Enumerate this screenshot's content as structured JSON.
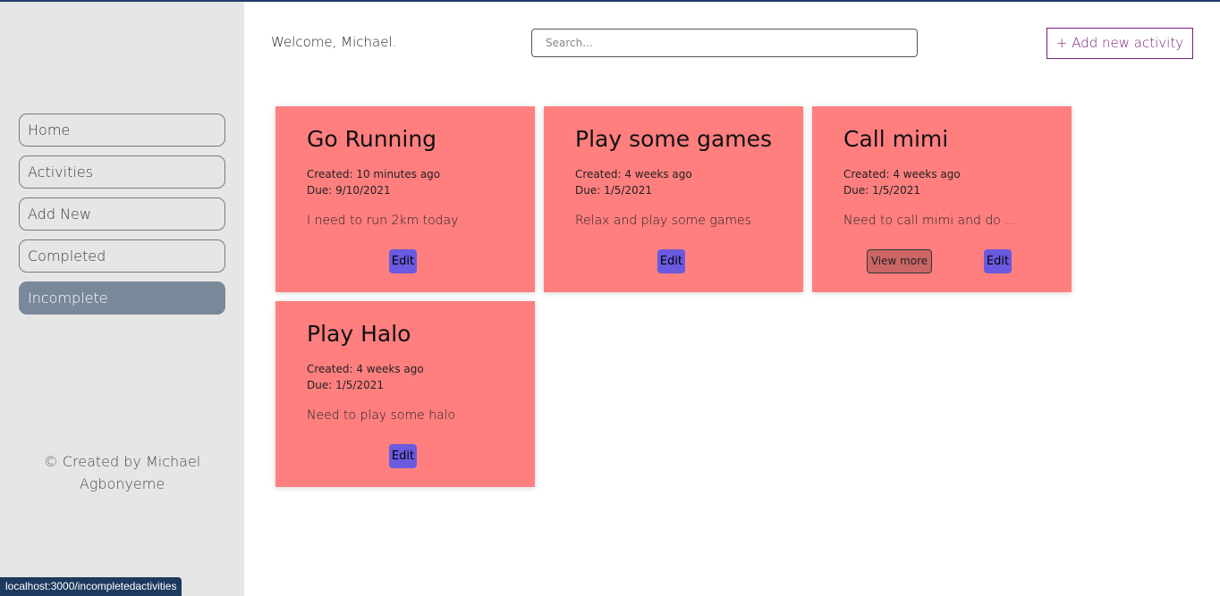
{
  "sidebar": {
    "nav": [
      {
        "label": "Home"
      },
      {
        "label": "Activities"
      },
      {
        "label": "Add New"
      },
      {
        "label": "Completed"
      },
      {
        "label": "Incomplete",
        "active": true
      }
    ],
    "credit": "© Created by Michael Agbonyeme"
  },
  "header": {
    "welcome": "Welcome, Michael.",
    "search_placeholder": "Search...",
    "add_label": "+ Add new activity"
  },
  "cards": [
    {
      "title": "Go Running",
      "created": "Created: 10 minutes ago",
      "due": "Due: 9/10/2021",
      "desc": "I need to run 2km today",
      "edit": "Edit"
    },
    {
      "title": "Play some games",
      "created": "Created: 4 weeks ago",
      "due": "Due: 1/5/2021",
      "desc": "Relax and play some games",
      "edit": "Edit"
    },
    {
      "title": "Call mimi",
      "created": "Created: 4 weeks ago",
      "due": "Due: 1/5/2021",
      "desc": "Need to call mimi and do ...",
      "edit": "Edit",
      "view_more": "View more"
    },
    {
      "title": "Play Halo",
      "created": "Created: 4 weeks ago",
      "due": "Due: 1/5/2021",
      "desc": "Need to play some halo",
      "edit": "Edit"
    }
  ],
  "status_bar": "localhost:3000/incompletedactivities",
  "colors": {
    "card": "#ff7f7f",
    "active_nav": "#7a8999",
    "edit_button": "#6a5ae0",
    "accent": "#7a1f7a"
  }
}
